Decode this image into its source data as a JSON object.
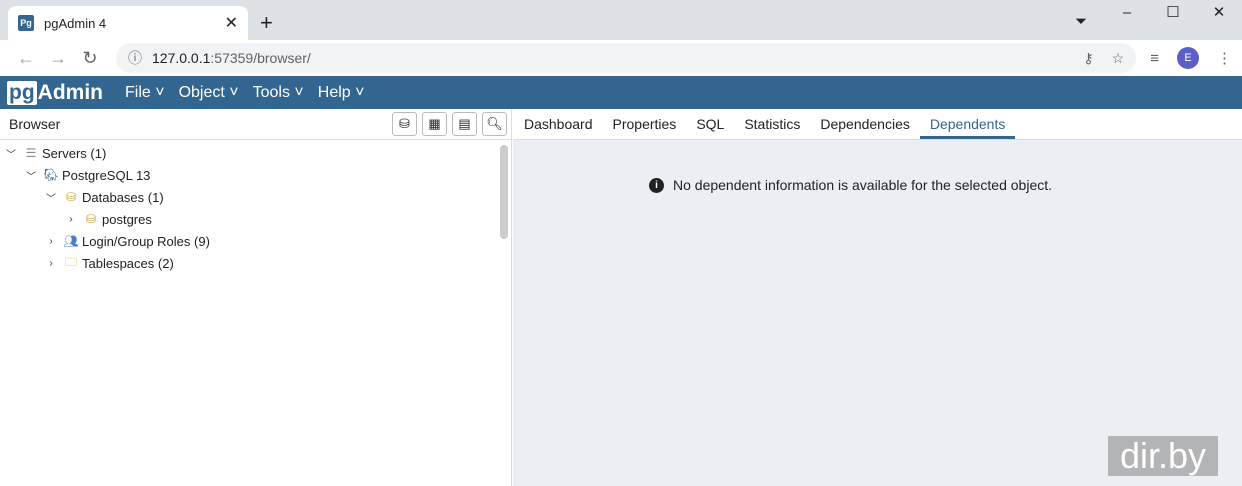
{
  "browser": {
    "tab_title": "pgAdmin 4",
    "url_host": "127.0.0.1",
    "url_rest": ":57359/browser/",
    "profile": "E"
  },
  "menubar": {
    "logo": "pgAdmin",
    "logo_pg": "pg",
    "logo_rest": "Admin",
    "items": [
      "File",
      "Object",
      "Tools",
      "Help"
    ]
  },
  "left": {
    "title": "Browser",
    "tree": [
      {
        "label": "Servers (1)",
        "icon": "servers-icon",
        "expanded": true
      },
      {
        "label": "PostgreSQL 13",
        "icon": "postgres-icon",
        "expanded": true
      },
      {
        "label": "Databases (1)",
        "icon": "database-icon",
        "expanded": true
      },
      {
        "label": "postgres",
        "icon": "database-icon",
        "expanded": false
      },
      {
        "label": "Login/Group Roles (9)",
        "icon": "roles-icon",
        "expanded": false
      },
      {
        "label": "Tablespaces (2)",
        "icon": "tablespace-icon",
        "expanded": false
      }
    ]
  },
  "right": {
    "tabs": [
      "Dashboard",
      "Properties",
      "SQL",
      "Statistics",
      "Dependencies",
      "Dependents"
    ],
    "active_tab": "Dependents",
    "message": "No dependent information is available for the selected object."
  },
  "watermark": "dir.by"
}
